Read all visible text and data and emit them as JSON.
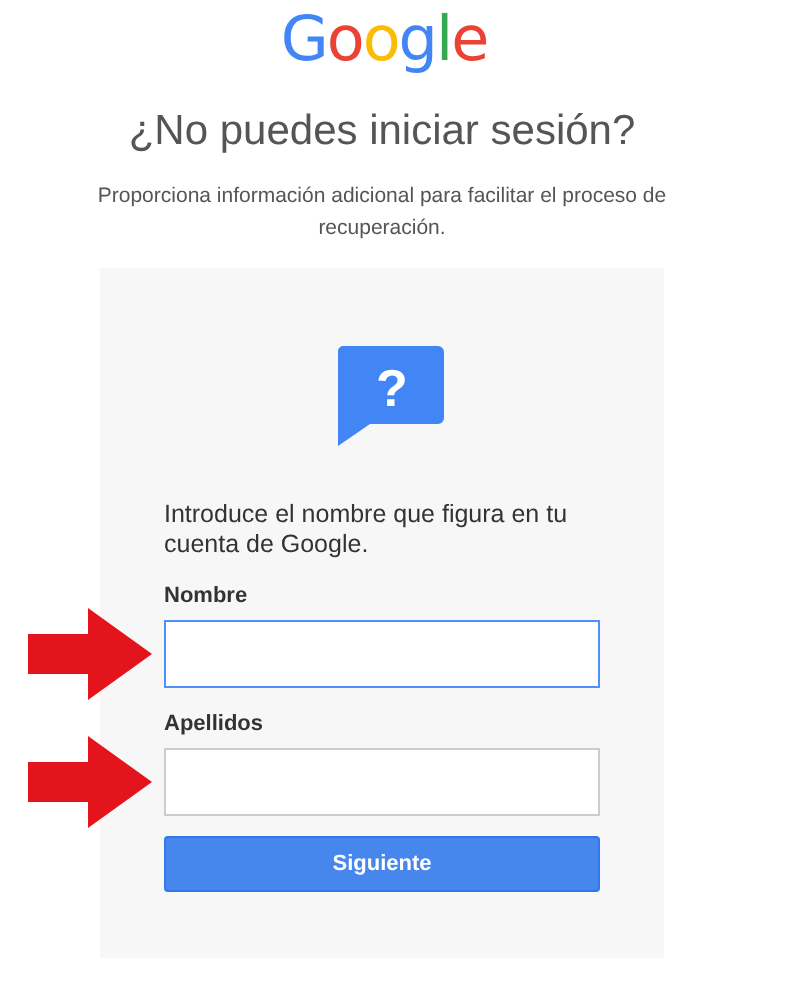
{
  "logo": {
    "letters": [
      {
        "char": "G",
        "color": "#4285f4"
      },
      {
        "char": "o",
        "color": "#ea4335"
      },
      {
        "char": "o",
        "color": "#fbbc05"
      },
      {
        "char": "g",
        "color": "#4285f4"
      },
      {
        "char": "l",
        "color": "#34a853"
      },
      {
        "char": "e",
        "color": "#ea4335"
      }
    ]
  },
  "title": "¿No puedes iniciar sesión?",
  "subtitle": "Proporciona información adicional para facilitar el proceso de recuperación.",
  "card": {
    "icon_text": "?",
    "prompt": "Introduce el nombre que figura en tu cuenta de Google.",
    "fields": [
      {
        "label": "Nombre",
        "focused": true,
        "arrow": true
      },
      {
        "label": "Apellidos",
        "focused": false,
        "arrow": true
      }
    ],
    "button": "Siguiente"
  }
}
